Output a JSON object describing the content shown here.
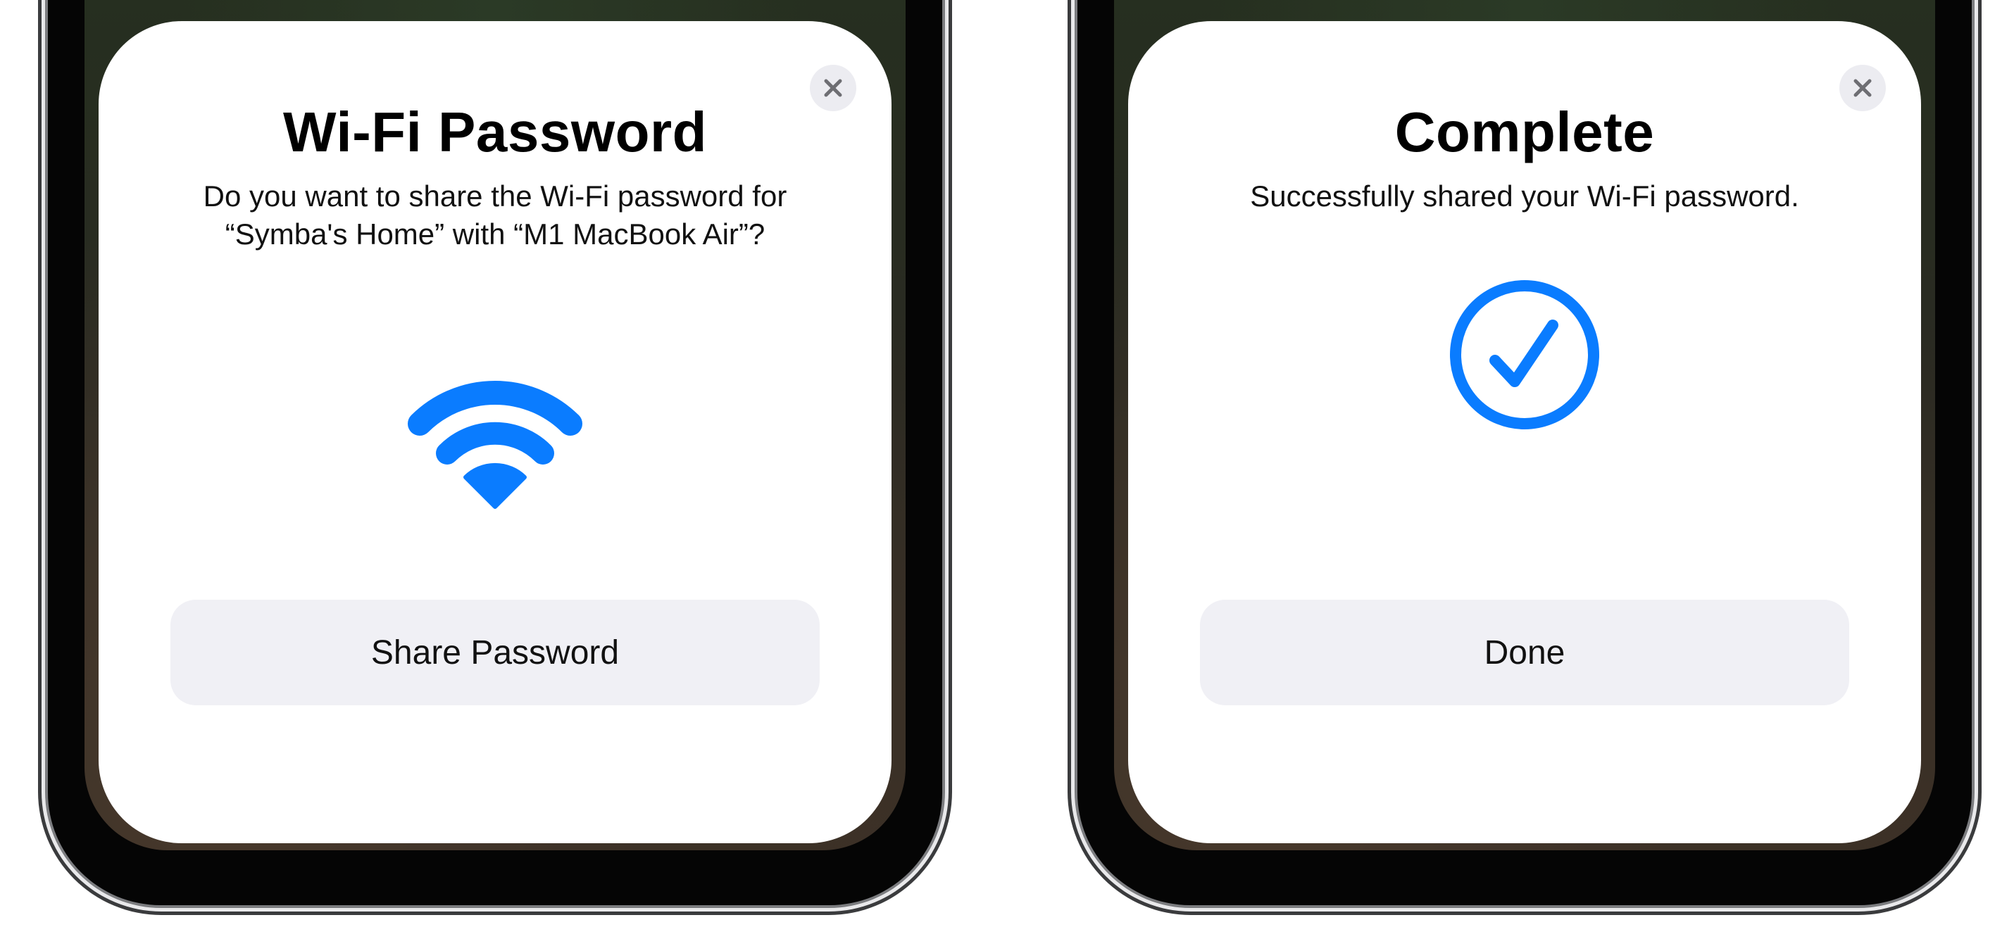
{
  "theme": {
    "accent": "#0a7cff",
    "button_bg": "#f0f0f5",
    "sheet_bg": "#ffffff",
    "close_bg": "#ececf1"
  },
  "panels": [
    {
      "title": "Wi-Fi Password",
      "description": "Do you want to share the Wi-Fi password for\n“Symba's Home” with “M1 MacBook Air”?",
      "icon": "wifi-icon",
      "button_label": "Share Password",
      "close_icon": "close-icon"
    },
    {
      "title": "Complete",
      "description": "Successfully shared your Wi-Fi password.",
      "icon": "checkmark-circle-icon",
      "button_label": "Done",
      "close_icon": "close-icon"
    }
  ]
}
